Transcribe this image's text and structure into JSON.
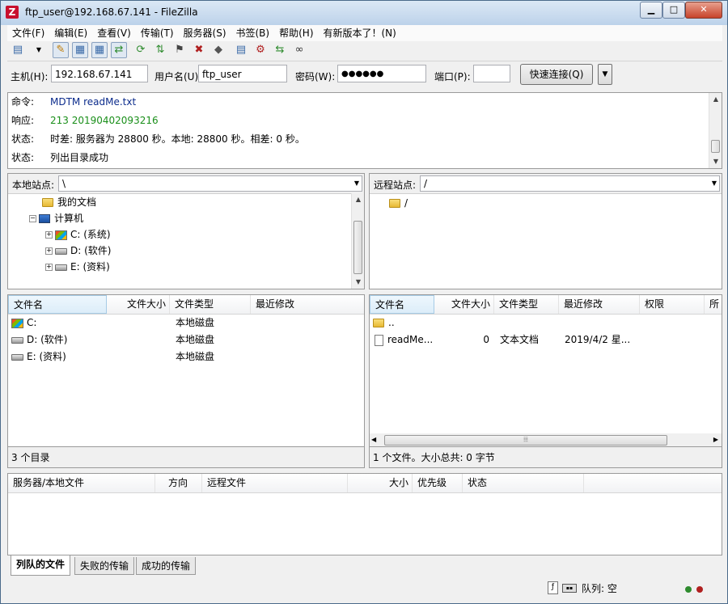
{
  "window": {
    "title": "ftp_user@192.168.67.141 - FileZilla",
    "app_icon": "Z"
  },
  "menu": [
    "文件(F)",
    "编辑(E)",
    "查看(V)",
    "传输(T)",
    "服务器(S)",
    "书签(B)",
    "帮助(H)",
    "有新版本了！(N)"
  ],
  "quickconnect": {
    "host_label": "主机(H):",
    "host_value": "192.168.67.141",
    "user_label": "用户名(U):",
    "user_value": "ftp_user",
    "pass_label": "密码(W):",
    "pass_value": "●●●●●●",
    "port_label": "端口(P):",
    "port_value": "",
    "button": "快速连接(Q)"
  },
  "log": [
    {
      "kind": "命令:",
      "text": "MDTM readMe.txt",
      "color": "#0c2c8c"
    },
    {
      "kind": "响应:",
      "text": "213 20190402093216",
      "color": "#1a8f1a"
    },
    {
      "kind": "状态:",
      "text": "时差: 服务器为 28800 秒。本地: 28800 秒。相差: 0 秒。",
      "color": "#000000"
    },
    {
      "kind": "状态:",
      "text": "列出目录成功",
      "color": "#000000"
    }
  ],
  "local": {
    "site_label": "本地站点:",
    "site_path": "\\",
    "tree": [
      {
        "label": "我的文档"
      },
      {
        "label": "计算机"
      },
      {
        "label": "C: (系统)"
      },
      {
        "label": "D: (软件)"
      },
      {
        "label": "E: (资料)"
      }
    ],
    "columns": [
      "文件名",
      "文件大小",
      "文件类型",
      "最近修改"
    ],
    "rows": [
      {
        "name": "C:",
        "size": "",
        "type": "本地磁盘",
        "modified": ""
      },
      {
        "name": "D: (软件)",
        "size": "",
        "type": "本地磁盘",
        "modified": ""
      },
      {
        "name": "E: (资料)",
        "size": "",
        "type": "本地磁盘",
        "modified": ""
      }
    ],
    "status": "3 个目录"
  },
  "remote": {
    "site_label": "远程站点:",
    "site_path": "/",
    "tree": [
      {
        "label": "/"
      }
    ],
    "columns": [
      "文件名",
      "文件大小",
      "文件类型",
      "最近修改",
      "权限",
      "所"
    ],
    "rows": [
      {
        "name": "..",
        "size": "",
        "type": "",
        "modified": ""
      },
      {
        "name": "readMe...",
        "size": "0",
        "type": "文本文档",
        "modified": "2019/4/2 星..."
      }
    ],
    "status": "1 个文件。大小总共: 0 字节"
  },
  "queue": {
    "columns": [
      "服务器/本地文件",
      "方向",
      "远程文件",
      "大小",
      "优先级",
      "状态"
    ],
    "tabs": [
      "列队的文件",
      "失败的传输",
      "成功的传输"
    ],
    "queue_text": "队列: 空"
  },
  "colors": {
    "accent": "#c8102e",
    "led_green": "#2e8b2e",
    "led_red": "#b02020"
  }
}
